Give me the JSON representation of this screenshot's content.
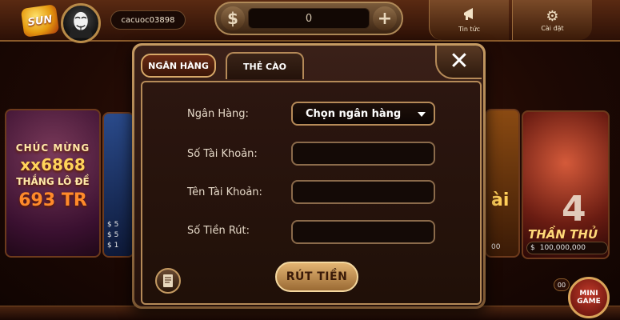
{
  "header": {
    "logo_text": "SUN",
    "username": "cacuoc03898",
    "balance": "0",
    "balance_currency_icon": "dollar-icon",
    "add_icon": "plus-icon",
    "news_label": "Tin tức",
    "settings_label": "Cài đặt"
  },
  "background_tiles": {
    "lotto": {
      "line1": "CHÚC MỪNG",
      "line2": "xx6868",
      "line3": "THẮNG LÔ ĐỀ",
      "line4": "693 TR"
    },
    "blue_tile": {
      "amounts": [
        "$ 5",
        "$ 5",
        "$ 1"
      ]
    },
    "right_tile": {
      "text": "ài",
      "amount": "00"
    },
    "than_tile": {
      "number": "4",
      "name": "THẦN THỦ",
      "prize_currency": "$",
      "prize": "100,000,000"
    },
    "minigame": {
      "label": "MINI GAME",
      "badge": "00"
    }
  },
  "dialog": {
    "tabs": [
      {
        "label": "NGÂN HÀNG",
        "active": true
      },
      {
        "label": "THẺ CÀO",
        "active": false
      }
    ],
    "close_label": "✕",
    "form": {
      "bank_label": "Ngân Hàng:",
      "bank_select_value": "Chọn ngân hàng",
      "account_number_label": "Số Tài Khoản:",
      "account_number_value": "",
      "account_name_label": "Tên Tài Khoản:",
      "account_name_value": "",
      "amount_label": "Số Tiền Rút:",
      "amount_value": ""
    },
    "submit_label": "RÚT TIỀN",
    "history_icon": "receipt-icon"
  },
  "colors": {
    "accent_gold": "#c49a62",
    "panel_bg": "#26120c",
    "button_gold": "#e3b472"
  }
}
